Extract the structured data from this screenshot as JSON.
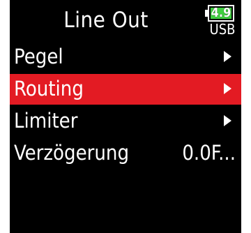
{
  "header": {
    "title": "Line Out",
    "battery": {
      "value": "4.9",
      "source": "USB",
      "fill_color": "#3fcf3f",
      "icon": "battery-icon"
    }
  },
  "menu": {
    "items": [
      {
        "label": "Pegel",
        "icon": "chevron-right-icon"
      },
      {
        "label": "Routing",
        "icon": "chevron-right-icon",
        "selected": true
      },
      {
        "label": "Limiter",
        "icon": "chevron-right-icon"
      },
      {
        "label": "Verzögerung",
        "value": "0.0F..."
      }
    ],
    "selected_color": "#e31b23"
  }
}
